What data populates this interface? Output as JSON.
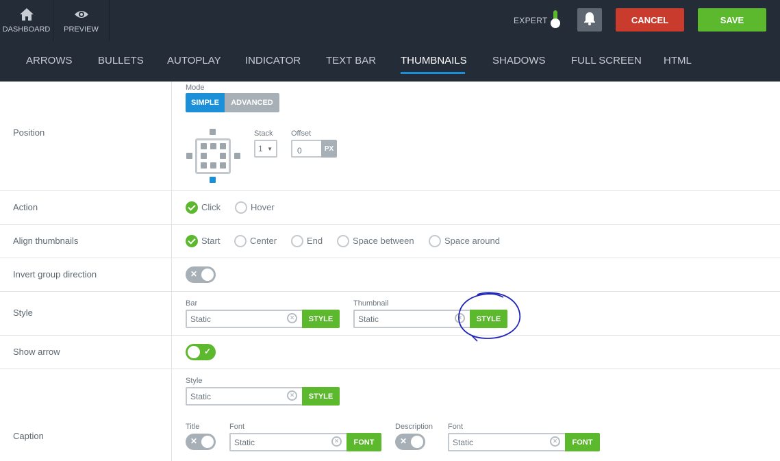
{
  "topbar": {
    "dashboard_label": "DASHBOARD",
    "preview_label": "PREVIEW",
    "expert_label": "EXPERT",
    "cancel_label": "CANCEL",
    "save_label": "SAVE",
    "icons": [
      "home-icon",
      "eye-icon",
      "bell-icon"
    ]
  },
  "tabs": [
    {
      "label": "ARROWS",
      "active": false
    },
    {
      "label": "BULLETS",
      "active": false
    },
    {
      "label": "AUTOPLAY",
      "active": false
    },
    {
      "label": "INDICATOR",
      "active": false
    },
    {
      "label": "TEXT BAR",
      "active": false
    },
    {
      "label": "THUMBNAILS",
      "active": true
    },
    {
      "label": "SHADOWS",
      "active": false
    },
    {
      "label": "FULL SCREEN",
      "active": false
    },
    {
      "label": "HTML",
      "active": false
    }
  ],
  "position": {
    "label": "Position",
    "mode_label": "Mode",
    "mode_options": [
      "SIMPLE",
      "ADVANCED"
    ],
    "mode_selected": "SIMPLE",
    "stack_label": "Stack",
    "stack_value": "1",
    "offset_label": "Offset",
    "offset_value": "0",
    "offset_unit": "PX",
    "selected_position": "bottom"
  },
  "action": {
    "label": "Action",
    "options": [
      "Click",
      "Hover"
    ],
    "selected": "Click"
  },
  "align": {
    "label": "Align thumbnails",
    "options": [
      "Start",
      "Center",
      "End",
      "Space between",
      "Space around"
    ],
    "selected": "Start"
  },
  "invert": {
    "label": "Invert group direction",
    "on": false
  },
  "style": {
    "label": "Style",
    "bar_label": "Bar",
    "bar_value": "Static",
    "bar_button": "STYLE",
    "thumb_label": "Thumbnail",
    "thumb_value": "Static",
    "thumb_button": "STYLE"
  },
  "show_arrow": {
    "label": "Show arrow",
    "on": true
  },
  "caption": {
    "label": "Caption",
    "style_label": "Style",
    "style_value": "Static",
    "style_button": "STYLE",
    "title_label": "Title",
    "title_on": false,
    "title_font_label": "Font",
    "title_font_value": "Static",
    "title_font_button": "FONT",
    "desc_label": "Description",
    "desc_on": false,
    "desc_font_label": "Font",
    "desc_font_value": "Static",
    "desc_font_button": "FONT"
  },
  "colors": {
    "dark_bg": "#232c37",
    "accent_blue": "#1b8fd8",
    "green": "#5cb82c",
    "red": "#c93b2c",
    "annotation": "#1f24b8"
  }
}
